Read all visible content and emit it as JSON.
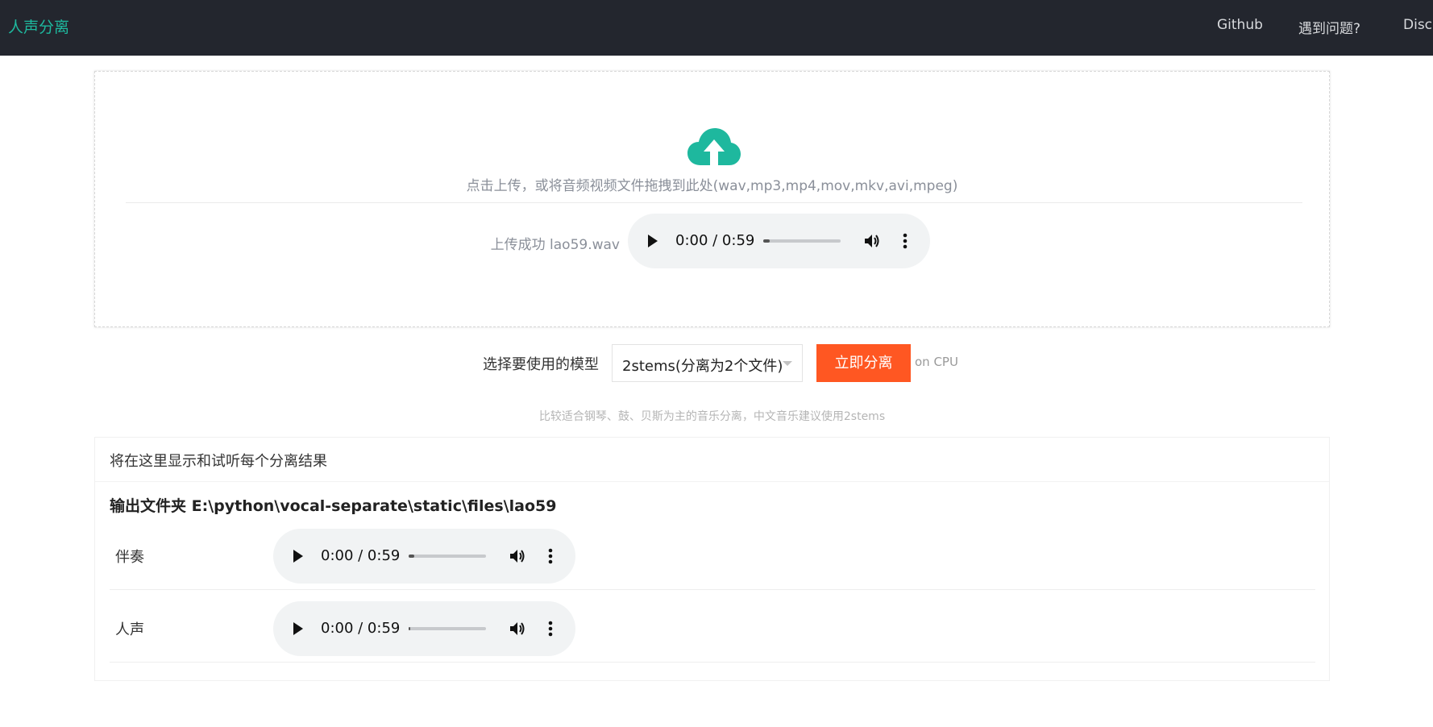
{
  "nav": {
    "brand": "人声分离",
    "links": [
      "Github",
      "遇到问题?",
      "Disc"
    ]
  },
  "upload": {
    "hint": "点击上传，或将音频视频文件拖拽到此处(wav,mp3,mp4,mov,mkv,avi,mpeg)",
    "status": "上传成功 lao59.wav",
    "player": {
      "time": "0:00 / 0:59",
      "progress": 0.08
    }
  },
  "model": {
    "label": "选择要使用的模型",
    "selected": "2stems(分离为2个文件)",
    "separate_button": "立即分离",
    "device": "on CPU",
    "tip": "比较适合钢琴、鼓、贝斯为主的音乐分离，中文音乐建议使用2stems"
  },
  "results": {
    "header": "将在这里显示和试听每个分离结果",
    "output_folder": "输出文件夹 E:\\python\\vocal-separate\\static\\files\\lao59",
    "tracks": [
      {
        "label": "伴奏",
        "time": "0:00 / 0:59",
        "progress": 0.07
      },
      {
        "label": "人声",
        "time": "0:00 / 0:59",
        "progress": 0.02
      }
    ]
  },
  "colors": {
    "topbar": "#23262e",
    "brand": "#1eb89e",
    "accent_button": "#ff5722",
    "cloud_icon": "#1eb89e"
  }
}
